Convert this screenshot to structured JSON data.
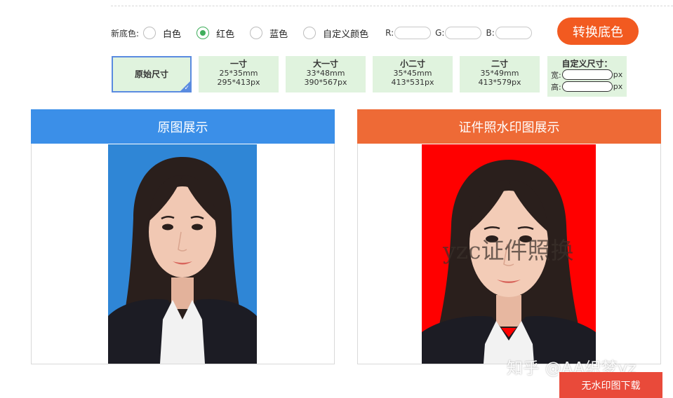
{
  "background": {
    "label": "新底色:",
    "options": [
      {
        "label": "白色",
        "checked": false
      },
      {
        "label": "红色",
        "checked": true
      },
      {
        "label": "蓝色",
        "checked": false
      },
      {
        "label": "自定义颜色",
        "checked": false
      }
    ],
    "rgb": {
      "r_label": "R:",
      "g_label": "G:",
      "b_label": "B:",
      "r_value": "",
      "g_value": "",
      "b_value": ""
    },
    "convert_label": "转换底色"
  },
  "sizes": [
    {
      "title": "原始尺寸",
      "selected": true
    },
    {
      "title": "一寸",
      "mm": "25*35mm",
      "px": "295*413px"
    },
    {
      "title": "大一寸",
      "mm": "33*48mm",
      "px": "390*567px"
    },
    {
      "title": "小二寸",
      "mm": "35*45mm",
      "px": "413*531px"
    },
    {
      "title": "二寸",
      "mm": "35*49mm",
      "px": "413*579px"
    }
  ],
  "custom_size": {
    "title": "自定义尺寸：",
    "width_label": "宽:",
    "height_label": "高:",
    "unit": "px",
    "width_value": "",
    "height_value": ""
  },
  "panels": {
    "original": {
      "title": "原图展示",
      "header_color": "#3b8fe8",
      "photo_bg": "#2f86d6"
    },
    "watermark": {
      "title": "证件照水印图展示",
      "header_color": "#ee6a36",
      "photo_bg": "#ff0000",
      "watermark_text": "yzc证件照换"
    }
  },
  "download_label": "无水印图下载",
  "site_watermark": "知乎 @AA织梦yz",
  "colors": {
    "accent_green": "#3fae5b",
    "convert_btn": "#f25a20",
    "download_btn": "#e94a3a",
    "size_card": "#e0f3de",
    "selected_border": "#5a8be0"
  }
}
